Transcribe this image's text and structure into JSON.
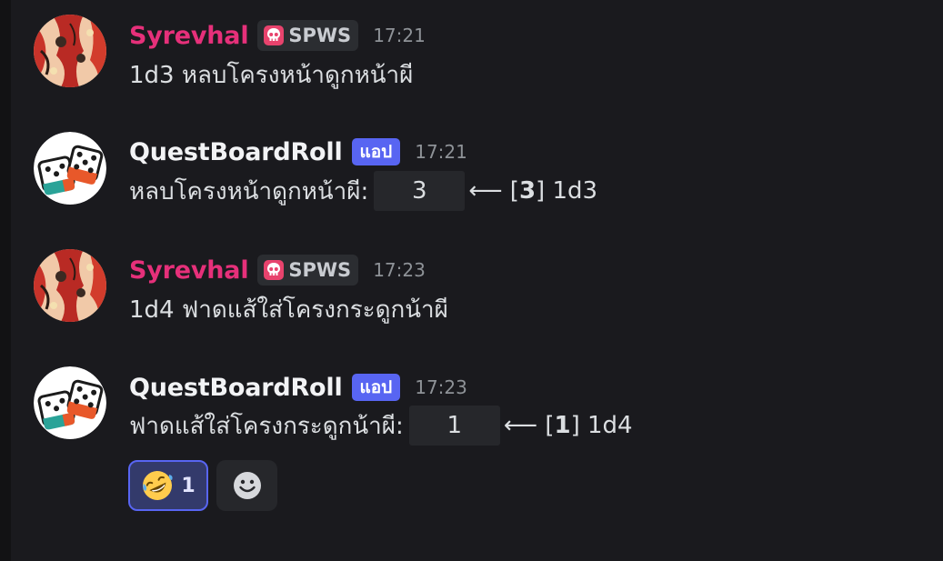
{
  "colors": {
    "background": "#1a1a1e",
    "syrevhal_name": "#e6307a",
    "bot_name": "#f2f3f5",
    "app_badge": "#5865f2",
    "reaction_active_border": "#5865f2"
  },
  "messages": [
    {
      "username": "Syrevhal",
      "tag": "SPWS",
      "tag_icon": "skull-icon",
      "timestamp": "17:21",
      "text": "1d3 หลบโครงหน้าดูกหน้าผี"
    },
    {
      "username": "QuestBoardRoll",
      "app_badge": "แอป",
      "timestamp": "17:21",
      "label": "หลบโครงหน้าดูกหน้าผี:",
      "result": "3",
      "arrow": "⟵ [",
      "bracket_value": "3",
      "suffix": "] 1d3"
    },
    {
      "username": "Syrevhal",
      "tag": "SPWS",
      "tag_icon": "skull-icon",
      "timestamp": "17:23",
      "text": "1d4 ฟาดแส้ใส่โครงกระดูกน้าผี"
    },
    {
      "username": "QuestBoardRoll",
      "app_badge": "แอป",
      "timestamp": "17:23",
      "label": "ฟาดแส้ใส่โครงกระดูกน้าผี:",
      "result": "1",
      "arrow": "⟵ [",
      "bracket_value": "1",
      "suffix": "] 1d4"
    }
  ],
  "reactions": [
    {
      "emoji": "🤣",
      "icon": "rofl-emoji-icon",
      "count": "1"
    },
    {
      "icon": "add-reaction-icon"
    }
  ]
}
